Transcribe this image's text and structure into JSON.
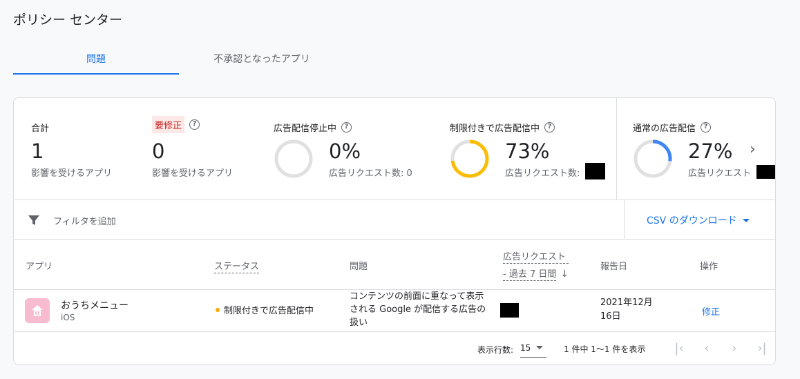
{
  "page": {
    "title": "ポリシー センター"
  },
  "tabs": [
    {
      "label": "問題",
      "active": true
    },
    {
      "label": "不承認となったアプリ",
      "active": false
    }
  ],
  "summary": {
    "total": {
      "title": "合計",
      "value": "1",
      "sub": "影響を受けるアプリ"
    },
    "needs_fix": {
      "title": "要修正",
      "value": "0",
      "sub": "影響を受けるアプリ"
    },
    "stopped": {
      "title": "広告配信停止中",
      "percent": "0%",
      "fraction": 0,
      "sub": "広告リクエスト数: 0"
    },
    "limited": {
      "title": "制限付きで広告配信中",
      "percent": "73%",
      "fraction": 0.73,
      "sub": "広告リクエスト数:"
    },
    "normal": {
      "title": "通常の広告配信",
      "percent": "27%",
      "fraction": 0.27,
      "sub": "広告リクエスト"
    },
    "colors": {
      "limited": "#fbbc04",
      "normal": "#4285f4",
      "ring": "#e0e0e0"
    }
  },
  "filter": {
    "placeholder": "フィルタを追加"
  },
  "csv": {
    "label": "CSV のダウンロード"
  },
  "table": {
    "headers": {
      "app": "アプリ",
      "status": "ステータス",
      "issue": "問題",
      "requests_line1": "広告リクエスト",
      "requests_line2": "- 過去 7 日間",
      "reported": "報告日",
      "action": "操作"
    },
    "rows": [
      {
        "app_name": "おうちメニュー",
        "platform": "iOS",
        "status": "制限付きで広告配信中",
        "issue": "コンテンツの前面に重なって表示される Google が配信する広告の扱い",
        "reported": "2021年12月16日",
        "action": "修正"
      }
    ]
  },
  "pager": {
    "rows_label": "表示行数:",
    "rows_value": "15",
    "range": "1 件中 1～1 件を表示"
  }
}
